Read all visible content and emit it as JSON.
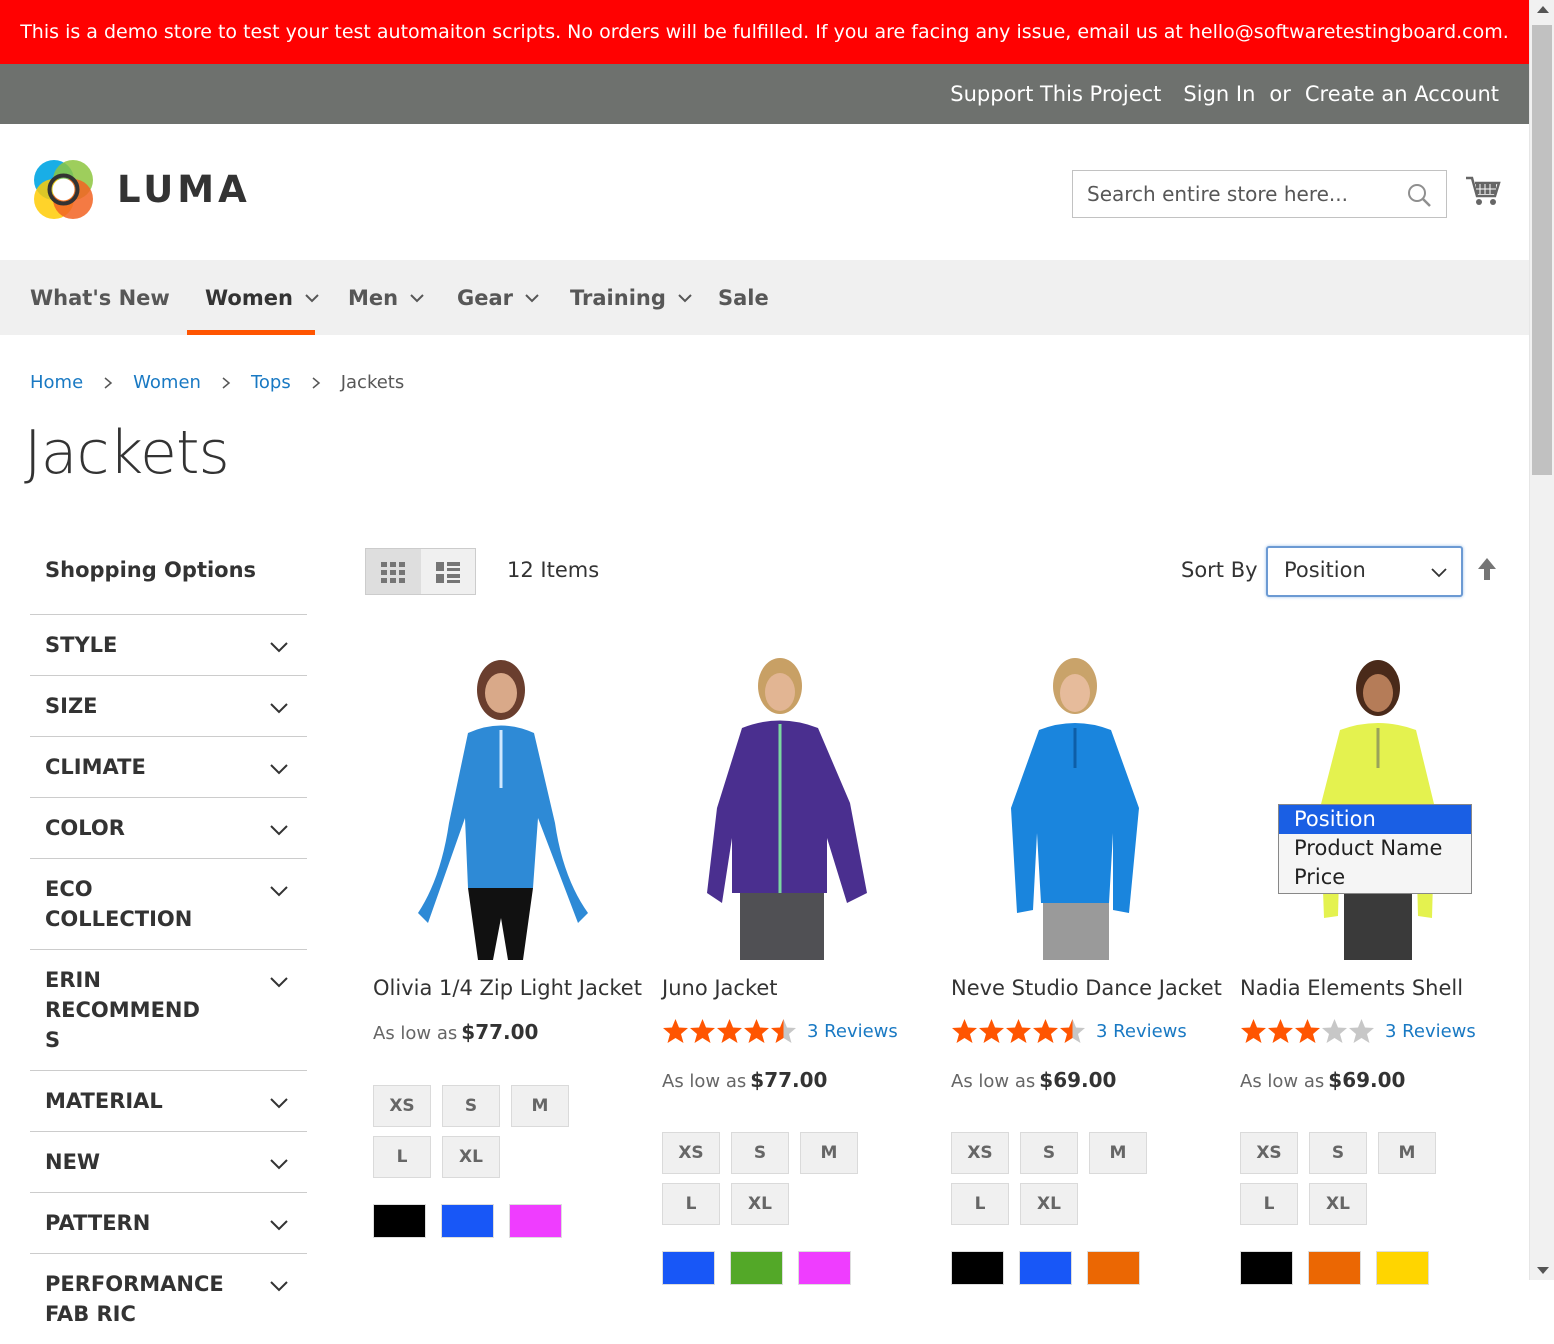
{
  "banner": {
    "text": "This is a demo store to test your test automaiton scripts. No orders will be fulfilled. If you are facing any issue, email us at hello@softwaretestingboard.com."
  },
  "header": {
    "support": "Support This Project",
    "sign_in": "Sign In",
    "or": "or",
    "create_account": "Create an Account"
  },
  "logo": {
    "text": "LUMA",
    "colors": [
      "#00a5e3",
      "#8dc63f",
      "#ffcb05",
      "#f26322"
    ]
  },
  "search": {
    "placeholder": "Search entire store here..."
  },
  "nav": {
    "items": [
      "What's New",
      "Women",
      "Men",
      "Gear",
      "Training",
      "Sale"
    ],
    "active": "Women",
    "active_color": "#ff5501"
  },
  "breadcrumbs": [
    "Home",
    "Women",
    "Tops",
    "Jackets"
  ],
  "page_title": "Jackets",
  "sidebar": {
    "title": "Shopping Options",
    "filters": [
      "STYLE",
      "SIZE",
      "CLIMATE",
      "COLOR",
      "ECO COLLECTION",
      "ERIN RECOMMEND S",
      "MATERIAL",
      "NEW",
      "PATTERN",
      "PERFORMANCE FAB RIC"
    ]
  },
  "toolbar": {
    "amount": "12 Items",
    "sort_label": "Sort By",
    "sort_value": "Position",
    "sort_options": [
      "Position",
      "Product Name",
      "Price"
    ]
  },
  "products": [
    {
      "name": "Olivia 1/4 Zip Light Jacket",
      "price_label": "As low as",
      "price": "$77.00",
      "rating": null,
      "reviews": "",
      "sizes": [
        "XS",
        "S",
        "M",
        "L",
        "XL"
      ],
      "colors": [
        "#000000",
        "#1857f7",
        "#ef3dff"
      ],
      "image": "woman in blue quarter-zip jacket"
    },
    {
      "name": "Juno Jacket",
      "price_label": "As low as",
      "price": "$77.00",
      "rating": 4.5,
      "reviews": "3 Reviews",
      "sizes": [
        "XS",
        "S",
        "M",
        "L",
        "XL"
      ],
      "colors": [
        "#1857f7",
        "#53a828",
        "#ef3dff"
      ],
      "image": "woman in purple puffer jacket"
    },
    {
      "name": "Neve Studio Dance Jacket",
      "price_label": "As low as",
      "price": "$69.00",
      "rating": 4.5,
      "reviews": "3 Reviews",
      "sizes": [
        "XS",
        "S",
        "M",
        "L",
        "XL"
      ],
      "colors": [
        "#000000",
        "#1857f7",
        "#eb6703"
      ],
      "image": "woman in bright blue quarter-zip"
    },
    {
      "name": "Nadia Elements Shell",
      "price_label": "As low as",
      "price": "$69.00",
      "rating": 3,
      "reviews": "3 Reviews",
      "sizes": [
        "XS",
        "S",
        "M",
        "L",
        "XL"
      ],
      "colors": [
        "#000000",
        "#eb6703",
        "#ffd500"
      ],
      "image": "woman in yellow-green shell"
    }
  ]
}
